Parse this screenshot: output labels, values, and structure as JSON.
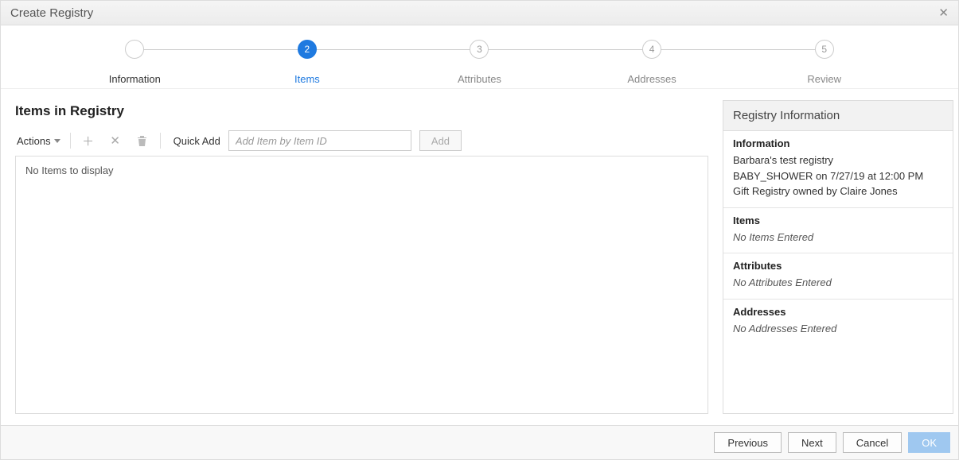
{
  "title": "Create Registry",
  "steps": [
    {
      "num": "",
      "label": "Information"
    },
    {
      "num": "2",
      "label": "Items"
    },
    {
      "num": "3",
      "label": "Attributes"
    },
    {
      "num": "4",
      "label": "Addresses"
    },
    {
      "num": "5",
      "label": "Review"
    }
  ],
  "main": {
    "heading": "Items in Registry",
    "actions_label": "Actions",
    "quickadd_label": "Quick Add",
    "quickadd_placeholder": "Add Item by Item ID",
    "add_button": "Add",
    "empty_text": "No Items to display"
  },
  "side": {
    "title": "Registry Information",
    "information": {
      "heading": "Information",
      "line1": "Barbara's test registry",
      "line2": "BABY_SHOWER on 7/27/19 at 12:00 PM",
      "line3": "Gift Registry owned by Claire Jones"
    },
    "items": {
      "heading": "Items",
      "text": "No Items Entered"
    },
    "attributes": {
      "heading": "Attributes",
      "text": "No Attributes Entered"
    },
    "addresses": {
      "heading": "Addresses",
      "text": "No Addresses Entered"
    }
  },
  "footer": {
    "previous": "Previous",
    "next": "Next",
    "cancel": "Cancel",
    "ok": "OK"
  }
}
